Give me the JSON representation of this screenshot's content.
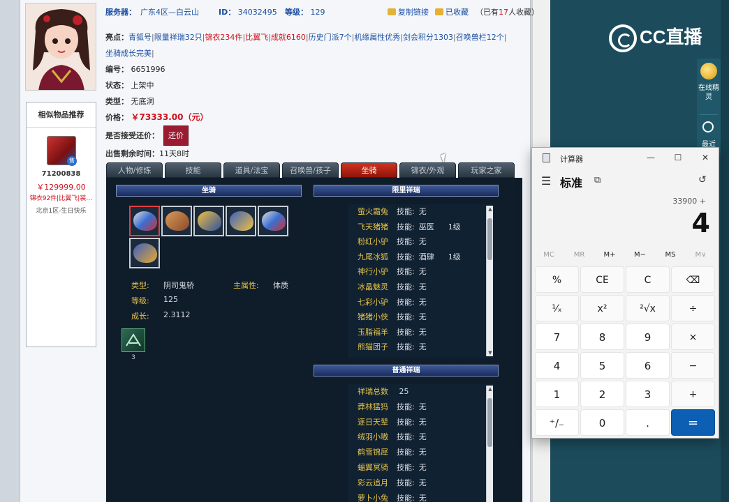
{
  "listing": {
    "server_label": "服务器：",
    "server_value": "广东4区—白云山",
    "id_label": "ID：",
    "id_value": "34032495",
    "level_label": "等级：",
    "level_value": "129",
    "copy_link": "复制链接",
    "favorited": "已收藏",
    "fav_prefix": "（已有",
    "fav_count": "17",
    "fav_suffix": "人收藏）",
    "highlights_label": "亮点：",
    "highlights": [
      {
        "text": "青狐号",
        "color": "#1a4fa3"
      },
      {
        "text": "限量祥瑞32只",
        "color": "#1a4fa3"
      },
      {
        "text": "锦衣234件",
        "color": "#d0101b"
      },
      {
        "text": "比翼飞",
        "color": "#d0101b"
      },
      {
        "text": "成就6160",
        "color": "#d0101b"
      },
      {
        "text": "历史门派7个",
        "color": "#1a4fa3"
      },
      {
        "text": "机缘属性优秀",
        "color": "#1a4fa3"
      },
      {
        "text": "剑会积分1303",
        "color": "#1a4fa3"
      },
      {
        "text": "召唤兽栏12个",
        "color": "#1a4fa3"
      },
      {
        "text": "坐骑成长完美",
        "color": "#1a4fa3"
      }
    ],
    "number_label": "编号：",
    "number_value": "6651996",
    "status_label": "状态：",
    "status_value": "上架中",
    "type_label": "类型：",
    "type_value": "无底洞",
    "price_label": "价格：",
    "price_value": "￥73333.00（元）",
    "bargain_label": "是否接受还价：",
    "bargain_button": "还价",
    "time_label": "出售剩余时间：",
    "time_value": "11天8时"
  },
  "similar": {
    "title": "相似物品推荐",
    "badge": "售",
    "item_id": "71200838",
    "price": "￥129999.00",
    "tags": "锦衣92件|比翼飞|装…",
    "server": "北京1区-生日快乐"
  },
  "tabs": [
    {
      "label": "人物/修炼",
      "active": false
    },
    {
      "label": "技能",
      "active": false
    },
    {
      "label": "道具/法宝",
      "active": false
    },
    {
      "label": "召唤兽/孩子",
      "active": false
    },
    {
      "label": "坐骑",
      "active": true
    },
    {
      "label": "锦衣/外观",
      "active": false
    },
    {
      "label": "玩家之家",
      "active": false
    }
  ],
  "mount": {
    "section_title": "坐骑",
    "type_label": "类型:",
    "type_value": "阴司鬼轿",
    "main_attr_label": "主属性:",
    "main_attr_value": "体质",
    "level_label": "等级:",
    "level_value": "125",
    "growth_label": "成长:",
    "growth_value": "2.3112",
    "skill_count": "3"
  },
  "limited": {
    "section_title": "限里祥瑞",
    "skill_label": "技能:",
    "items": [
      {
        "name": "萤火霜兔",
        "skill": "无",
        "level": ""
      },
      {
        "name": "飞天猪猪",
        "skill": "巫医",
        "level": "1级"
      },
      {
        "name": "粉红小驴",
        "skill": "无",
        "level": ""
      },
      {
        "name": "九尾冰狐",
        "skill": "酒肆",
        "level": "1级"
      },
      {
        "name": "神行小驴",
        "skill": "无",
        "level": ""
      },
      {
        "name": "冰晶魅灵",
        "skill": "无",
        "level": ""
      },
      {
        "name": "七彩小驴",
        "skill": "无",
        "level": ""
      },
      {
        "name": "猪猪小侠",
        "skill": "无",
        "level": ""
      },
      {
        "name": "玉脂福羊",
        "skill": "无",
        "level": ""
      },
      {
        "name": "熊猫团子",
        "skill": "无",
        "level": ""
      }
    ]
  },
  "normal": {
    "section_title": "普通祥瑞",
    "total_label": "祥瑞总数",
    "total_value": "25",
    "skill_label": "技能:",
    "items": [
      {
        "name": "莽林猛犸",
        "skill": "无"
      },
      {
        "name": "逐日天辇",
        "skill": "无"
      },
      {
        "name": "绒羽小嗷",
        "skill": "无"
      },
      {
        "name": "鹤雪锦犀",
        "skill": "无"
      },
      {
        "name": "蝠翼冥骑",
        "skill": "无"
      },
      {
        "name": "彩云追月",
        "skill": "无"
      },
      {
        "name": "萝卜小兔",
        "skill": "无"
      }
    ]
  },
  "cc": {
    "logo": "CC直播",
    "spirit": "在线精灵",
    "recent": "最近"
  },
  "calculator": {
    "title": "计算器",
    "mode": "标准",
    "expression": "33900 +",
    "display": "4",
    "memory": [
      {
        "label": "MC",
        "enabled": false
      },
      {
        "label": "MR",
        "enabled": false
      },
      {
        "label": "M+",
        "enabled": true
      },
      {
        "label": "M−",
        "enabled": true
      },
      {
        "label": "MS",
        "enabled": true
      },
      {
        "label": "M∨",
        "enabled": false
      }
    ],
    "keys": [
      [
        "%",
        "CE",
        "C",
        "⌫"
      ],
      [
        "¹⁄ₓ",
        "x²",
        "²√x",
        "÷"
      ],
      [
        "7",
        "8",
        "9",
        "×"
      ],
      [
        "4",
        "5",
        "6",
        "−"
      ],
      [
        "1",
        "2",
        "3",
        "+"
      ],
      [
        "⁺∕₋",
        "0",
        ".",
        "="
      ]
    ]
  },
  "colors": {
    "accent_blue": "#1a4fa3",
    "price_red": "#d0101b",
    "panel_dark": "#0f1c2a",
    "calc_equals": "#0d5fb3",
    "cc_teal": "#1c4c5c"
  }
}
